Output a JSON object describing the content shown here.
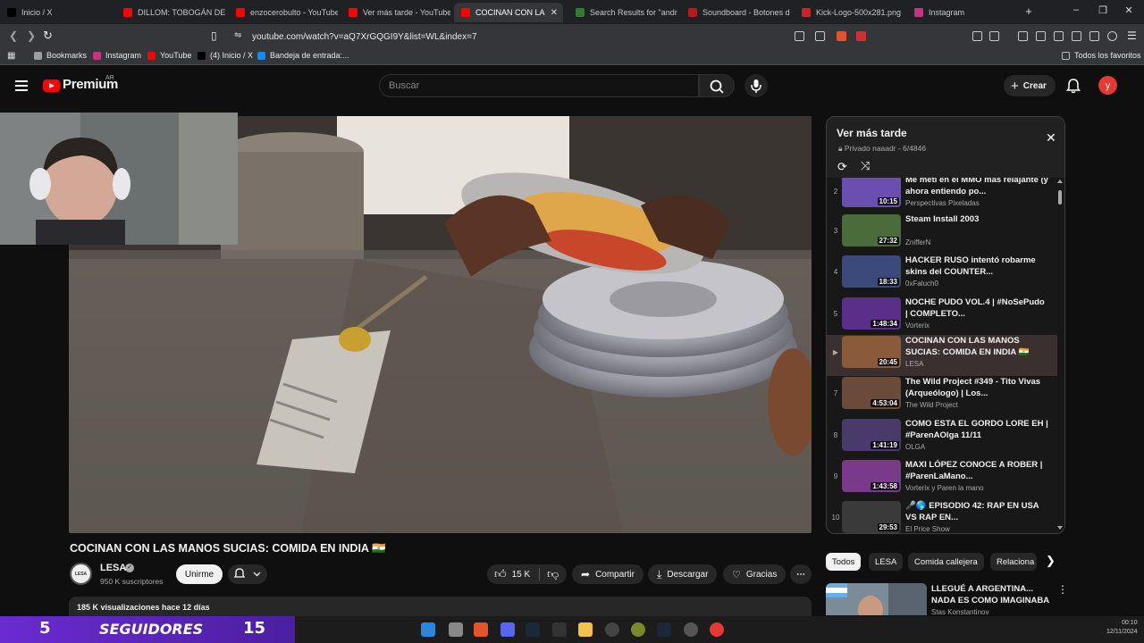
{
  "browser": {
    "tabs": [
      {
        "label": "Inicio / X",
        "color": "#000000"
      },
      {
        "label": "DILLOM: TOBOGÁN DE AL",
        "color": "#ff0000"
      },
      {
        "label": "enzocerobulto - YouTube",
        "color": "#ff0000"
      },
      {
        "label": "Ver más tarde - YouTube",
        "color": "#ff0000"
      },
      {
        "label": "COCINAN CON LA",
        "color": "#ff0000"
      },
      {
        "label": "Search Results for \"andre",
        "color": "#2e7d32"
      },
      {
        "label": "Soundboard - Botones de",
        "color": "#b71c1c"
      },
      {
        "label": "Kick-Logo-500x281.png (5",
        "color": "#c62828"
      },
      {
        "label": "Instagram",
        "color": "#c13584"
      }
    ],
    "new_tab": "+",
    "url": "youtube.com/watch?v=aQ7XrGQGI9Y&list=WL&index=7",
    "bookmarks": [
      {
        "label": "Bookmarks",
        "color": "#9e9e9e"
      },
      {
        "label": "Instagram",
        "color": "#c13584"
      },
      {
        "label": "YouTube",
        "color": "#ff0000"
      },
      {
        "label": "(4) Inicio / X",
        "color": "#000000"
      },
      {
        "label": "Bandeja de entrada:...",
        "color": "#1e88e5"
      }
    ],
    "all_favorites": "Todos los favoritos"
  },
  "youtube": {
    "logo_text": "Premium",
    "logo_country": "AR",
    "search_placeholder": "Buscar",
    "create_label": "Crear",
    "avatar_letter": "y"
  },
  "video": {
    "title": "COCINAN CON LAS MANOS SUCIAS: COMIDA EN INDIA 🇮🇳",
    "channel": "LESA",
    "subscribers": "950 K suscriptores",
    "channel_badge": "LESA",
    "join": "Unirme",
    "likes": "15 K",
    "share": "Compartir",
    "download": "Descargar",
    "thanks": "Gracias",
    "meta": "185 K visualizaciones  hace 12 días"
  },
  "playlist": {
    "title": "Ver más tarde",
    "subtitle": "Privado naaadr - 6/4846",
    "items": [
      {
        "idx": "2",
        "title": "Me metí en el MMO más relajante (y ahora entiendo po...",
        "channel": "Perspectivas Pixeladas",
        "duration": "10:15",
        "thumb": "#6a4fb0"
      },
      {
        "idx": "3",
        "title": "Steam Install 2003",
        "channel": "ZnifferN",
        "duration": "27:32",
        "thumb": "#4a6b3a"
      },
      {
        "idx": "4",
        "title": "HACKER RUSO intentó robarme skins del COUNTER...",
        "channel": "0xFaluch0",
        "duration": "18:33",
        "thumb": "#3b4a7a"
      },
      {
        "idx": "5",
        "title": "NOCHE PUDO VOL.4 | #NoSePudo | COMPLETO...",
        "channel": "Vorterix",
        "duration": "1:48:34",
        "thumb": "#5a2f8a"
      },
      {
        "idx": "▶",
        "title": "COCINAN CON LAS MANOS SUCIAS: COMIDA EN INDIA 🇮🇳",
        "channel": "LESA",
        "duration": "20:45",
        "thumb": "#8a5a3a",
        "current": true
      },
      {
        "idx": "7",
        "title": "The Wild Project #349 - Tito Vivas (Arqueólogo) | Los...",
        "channel": "The Wild Project",
        "duration": "4:53:04",
        "thumb": "#6b4a3a"
      },
      {
        "idx": "8",
        "title": "COMO ESTA EL GORDO LORE EH | #ParenAOlga 11/11",
        "channel": "OLGA",
        "duration": "1:41:19",
        "thumb": "#4a3a6b"
      },
      {
        "idx": "9",
        "title": "MAXI LÓPEZ CONOCE A ROBER | #ParenLaMano...",
        "channel": "Vorterix y Paren la mano",
        "duration": "1:43:58",
        "thumb": "#7a3a8a"
      },
      {
        "idx": "10",
        "title": "🎤🌎 EPISODIO 42: RAP EN USA VS RAP EN...",
        "channel": "El Price Show",
        "duration": "29:53",
        "thumb": "#3a3a3a"
      }
    ]
  },
  "chips": [
    "Todos",
    "LESA",
    "Comida callejera",
    "Relaciona"
  ],
  "recommendation": {
    "title": "LLEGUÉ A ARGENTINA... NADA ES COMO IMAGINABA",
    "channel": "Stas Konstantinov"
  },
  "stream_overlay": {
    "left_number": "5",
    "label": "SEGUIDORES",
    "right_number": "15"
  },
  "clock": {
    "time": "00:10",
    "date": "12/11/2024"
  }
}
